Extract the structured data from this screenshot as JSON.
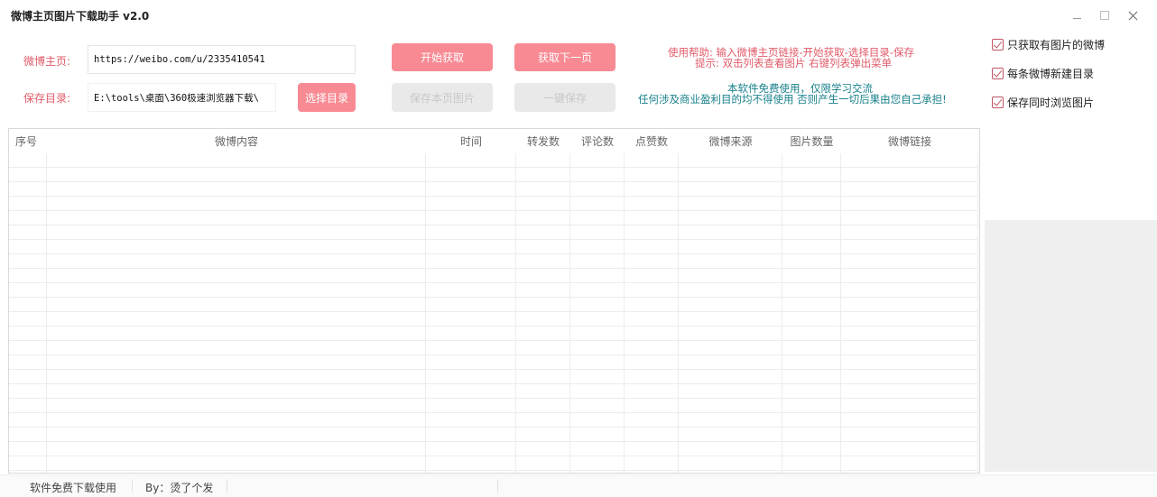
{
  "window": {
    "title": "微博主页图片下载助手 v2.0"
  },
  "form": {
    "homepage_label": "微博主页:",
    "homepage_value": "https://weibo.com/u/2335410541",
    "savedir_label": "保存目录:",
    "savedir_value": "E:\\tools\\桌面\\360极速浏览器下载\\"
  },
  "buttons": {
    "start": "开始获取",
    "next_page": "获取下一页",
    "choose_dir": "选择目录",
    "save_page": "保存本页图片",
    "save_all": "一键保存"
  },
  "help": {
    "line1": "使用帮助:  输入微博主页链接-开始获取-选择目录-保存",
    "line2": "提示:  双击列表查看图片  右键列表弹出菜单",
    "notice1": "本软件免费使用，仅限学习交流",
    "notice2": "任何涉及商业盈利目的均不得使用  否则产生一切后果由您自己承担!"
  },
  "options": [
    {
      "label": "只获取有图片的微博",
      "checked": true
    },
    {
      "label": "每条微博新建目录",
      "checked": true
    },
    {
      "label": "保存同时浏览图片",
      "checked": true
    }
  ],
  "table": {
    "columns": [
      "序号",
      "微博内容",
      "时间",
      "转发数",
      "评论数",
      "点赞数",
      "微博来源",
      "图片数量",
      "微博链接"
    ],
    "rows": []
  },
  "status": {
    "left": "软件免费下载使用",
    "author": "By：烫了个发"
  },
  "colors": {
    "accent": "#f88a93",
    "label_red": "#e05a68",
    "notice_teal": "#17808a"
  }
}
